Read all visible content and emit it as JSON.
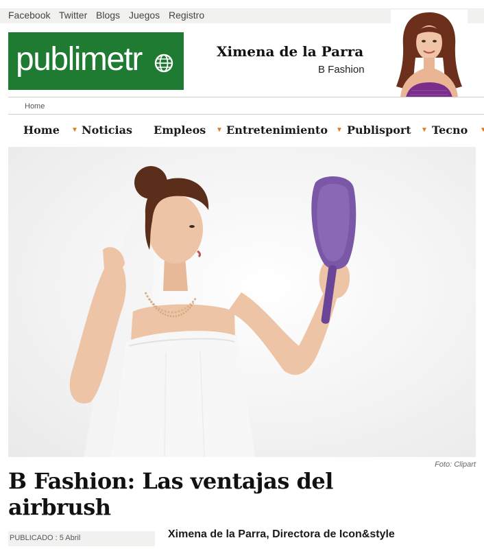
{
  "topbar": {
    "links": [
      "Facebook",
      "Twitter",
      "Blogs",
      "Juegos",
      "Registro"
    ]
  },
  "logo": {
    "text": "publimetr"
  },
  "author_block": {
    "name": "Ximena de la Parra",
    "section": "B Fashion"
  },
  "breadcrumb": {
    "home": "Home"
  },
  "nav": {
    "items": [
      "Home",
      "Noticias",
      "Empleos",
      "Entretenimiento",
      "Publisport",
      "Tecno"
    ]
  },
  "photo": {
    "credit": "Foto: Clipart"
  },
  "article": {
    "title_line1": "B Fashion: Las ventajas del",
    "title_line2": "airbrush",
    "published_label": "PUBLICADO : 5 Abril",
    "byline": "Ximena de la Parra, Directora de Icon&style"
  },
  "colors": {
    "brand_green": "#1f7a32",
    "nav_bullet": "#e07a22"
  }
}
